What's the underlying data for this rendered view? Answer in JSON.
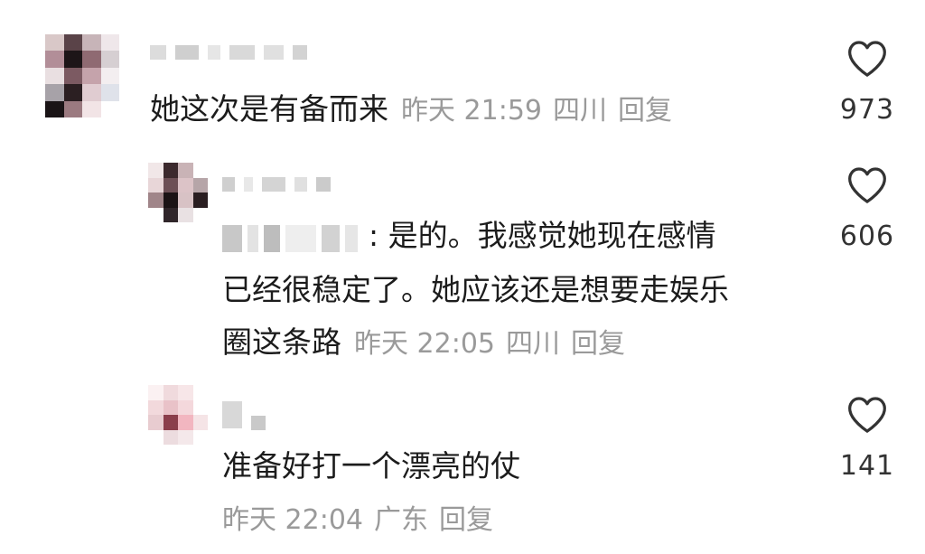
{
  "comments": [
    {
      "text": "她这次是有备而来",
      "date": "昨天 21:59",
      "location": "四川",
      "reply_label": "回复",
      "likes": "973",
      "like_icon": "heart-outline-icon"
    },
    {
      "text_line1": ": 是的。我感觉她现在感情",
      "text_line2": "已经很稳定了。她应该还是想要走娱乐",
      "text_line3": "圈这条路",
      "date": "昨天 22:05",
      "location": "四川",
      "reply_label": "回复",
      "likes": "606",
      "like_icon": "heart-outline-icon"
    },
    {
      "text": "准备好打一个漂亮的仗",
      "date": "昨天 22:04",
      "location": "广东",
      "reply_label": "回复",
      "likes": "141",
      "like_icon": "heart-outline-icon"
    }
  ],
  "colors": {
    "text": "#1c1c1c",
    "meta": "#9a9a9a",
    "icon": "#333333",
    "background": "#ffffff"
  }
}
